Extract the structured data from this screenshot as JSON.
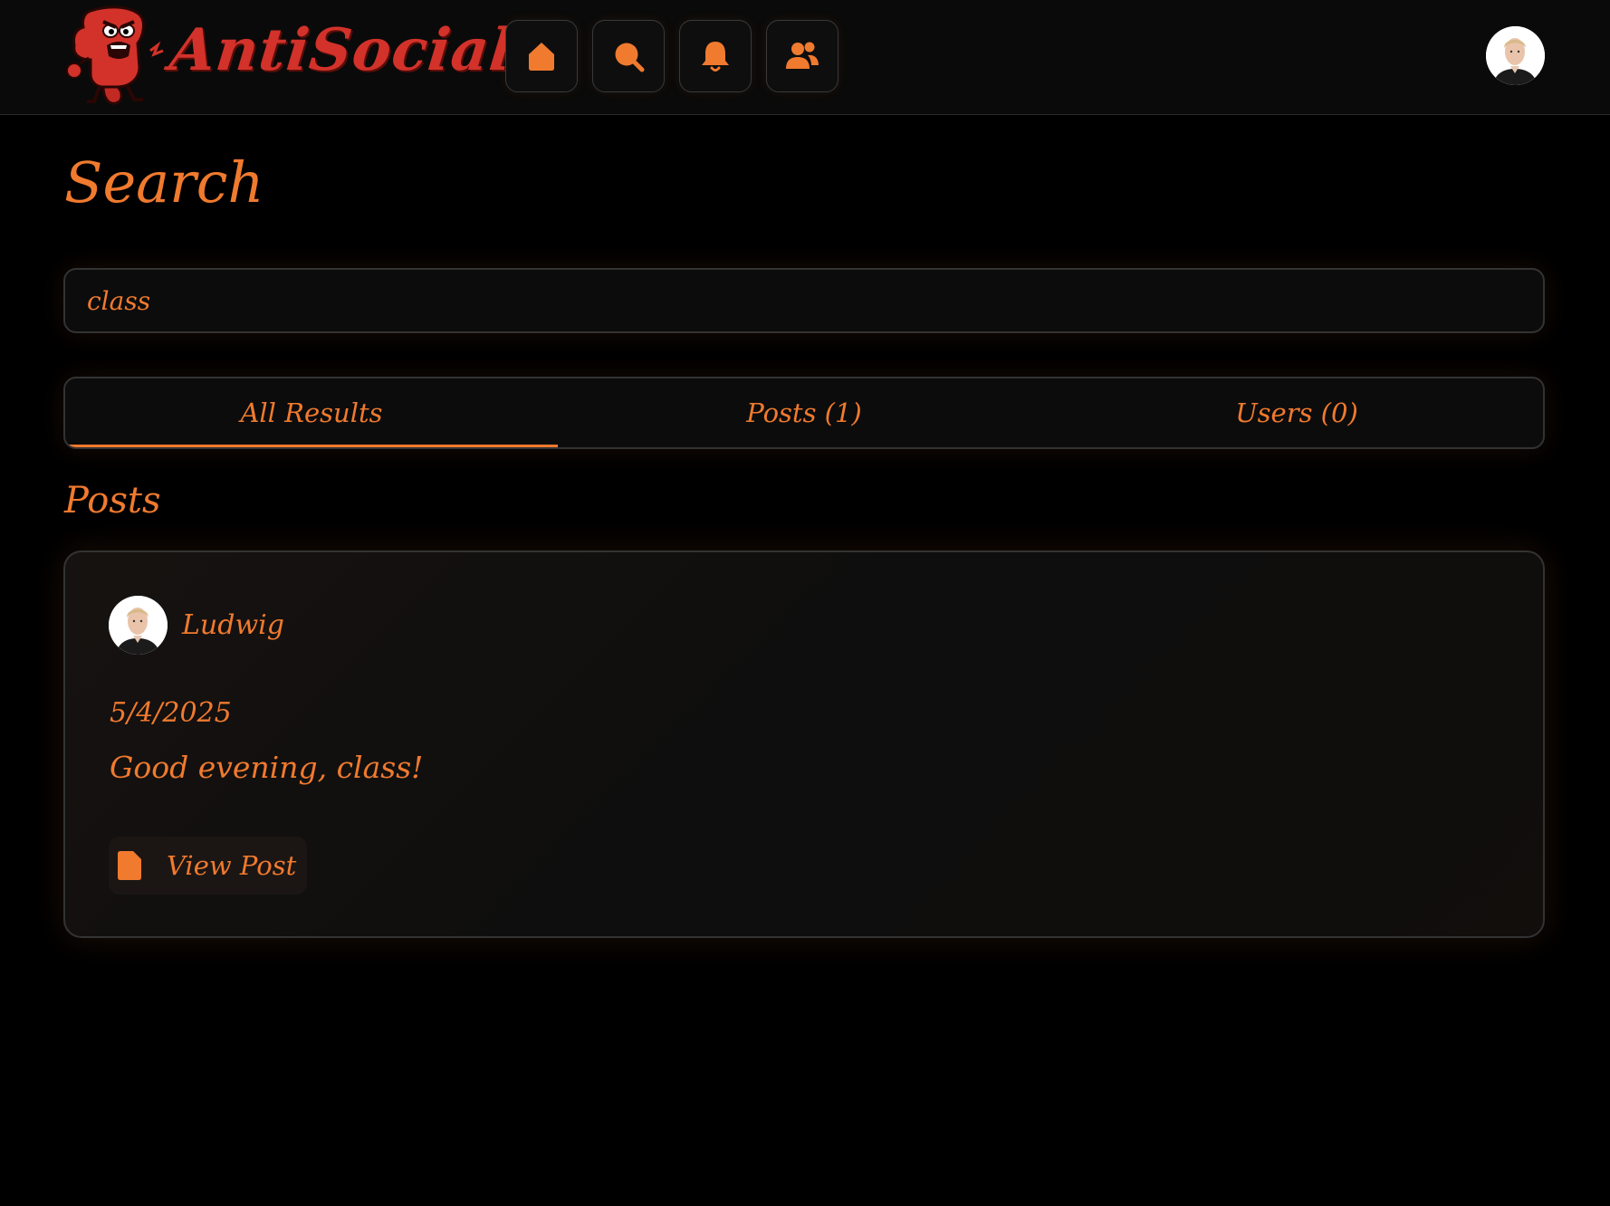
{
  "header": {
    "logo_text": "AntiSocial",
    "nav": [
      {
        "icon": "home-icon"
      },
      {
        "icon": "search-icon"
      },
      {
        "icon": "bell-icon"
      },
      {
        "icon": "users-icon"
      }
    ],
    "accent_color": "#f07a2e",
    "logo_color": "#d2322a"
  },
  "main": {
    "title": "Search",
    "search": {
      "value": "class"
    },
    "tabs": [
      {
        "label": "All Results",
        "active": true
      },
      {
        "label": "Posts (1)",
        "active": false
      },
      {
        "label": "Users (0)",
        "active": false
      }
    ],
    "section_title": "Posts",
    "posts": [
      {
        "author": "Ludwig",
        "date": "5/4/2025",
        "content": "Good evening, class!",
        "action_label": "View Post"
      }
    ]
  }
}
